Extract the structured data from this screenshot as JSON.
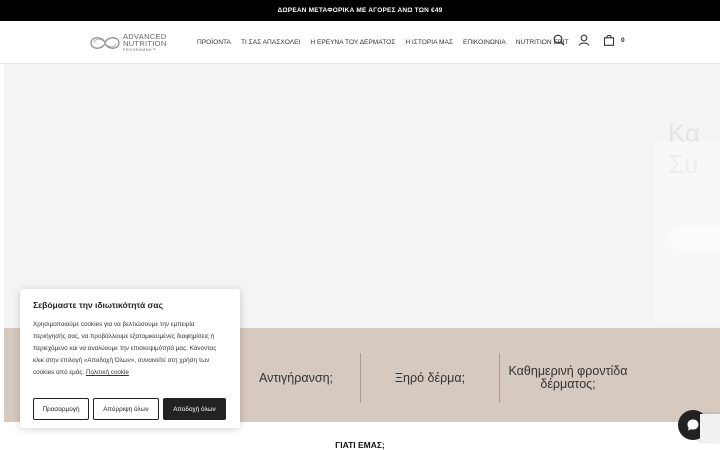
{
  "topbar": {
    "text": "ΔΩΡΕΑΝ ΜΕΤΑΦΟΡΙΚΑ ΜΕ ΑΓΟΡΕΣ ΑΝΩ ΤΩΝ €49"
  },
  "logo": {
    "line1": "ADVANCED",
    "line2": "NUTRITION",
    "line3": "PROGRAMME™"
  },
  "nav": {
    "items": [
      "ΠΡΟΪΟΝΤΑ",
      "ΤΙ ΣΑΣ ΑΠΑΣΧΟΛΕΙ",
      "Η ΕΡΕΥΝΑ ΤΟΥ ΔΕΡΜΑΤΟΣ",
      "Η ΙΣΤΟΡΙΑ ΜΑΣ",
      "ΕΠΙΚΟΙΝΩΝΙΑ",
      "NUTRITION EDIT"
    ]
  },
  "header_icons": {
    "search": "search-icon",
    "account": "user-icon",
    "cart": "bag-icon",
    "cart_count": "0"
  },
  "categories": [
    "Αντιγήρανση;",
    "Ξηρό δέρμα;",
    "Καθημερινή φροντίδα δέρματος;"
  ],
  "section": {
    "why_title": "ΓΙΑΤΙ ΕΜΑΣ;"
  },
  "cookie": {
    "title": "Σεβόμαστε την ιδιωτικότητά σας",
    "body": "Χρησιμοποιούμε cookies για να βελτιώσουμε την εμπειρία περιήγησής σας, να προβάλλουμε εξατομικευμένες διαφημίσεις ή περιεχόμενο και να αναλύουμε την επισκεψιμότητά μας. Κάνοντας κλικ στην επιλογή «Αποδοχή Όλων», συναινείτε στη χρήση των cookies από εμάς.",
    "link": "Πολιτική cookie",
    "btn_customize": "Προσαρμογή",
    "btn_reject": "Απόρριψη όλων",
    "btn_accept": "Αποδοχή όλων"
  },
  "colors": {
    "topbar": "#000000",
    "category_band": "#d6c9bf",
    "accept_button": "#222222"
  }
}
